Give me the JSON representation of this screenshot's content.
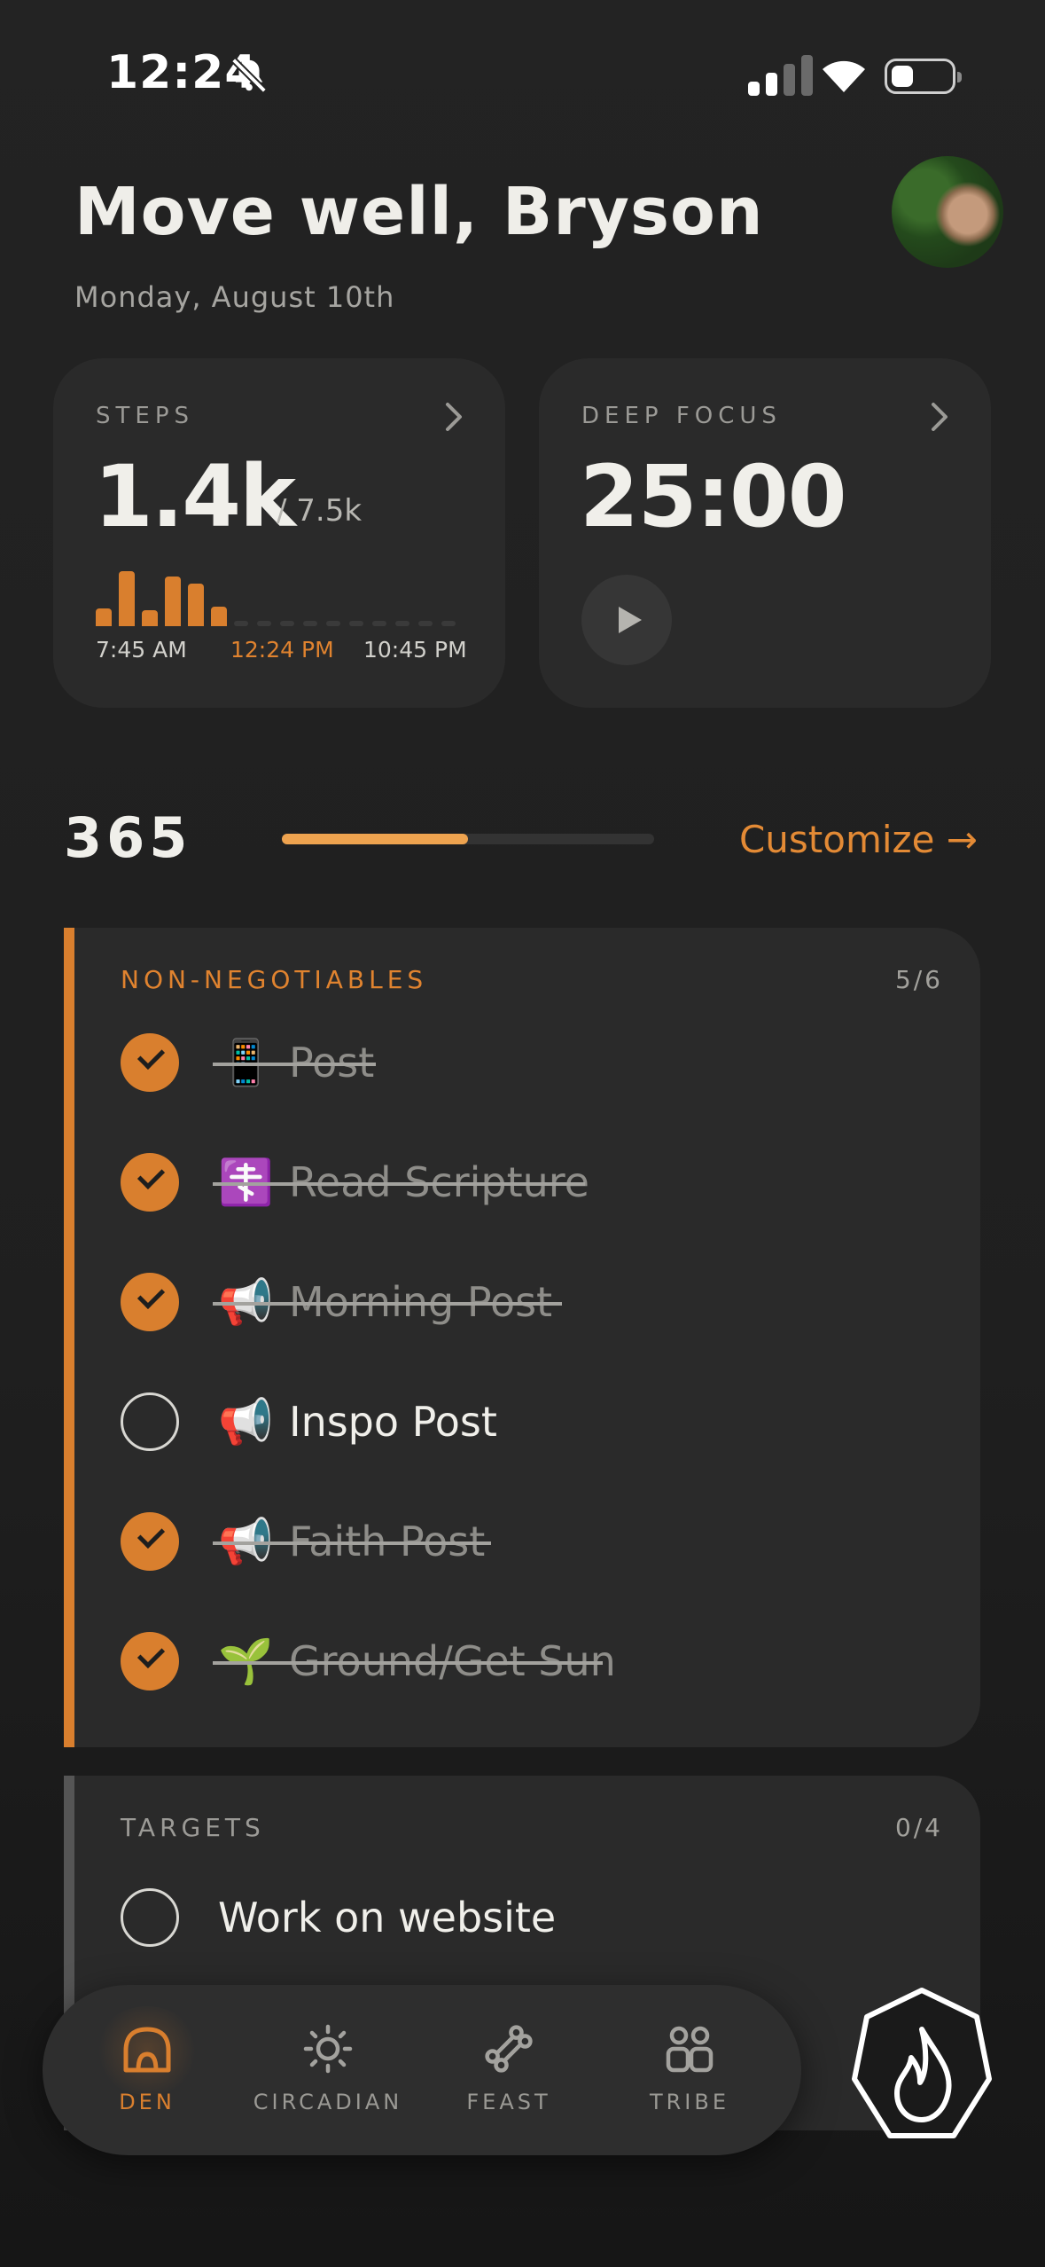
{
  "status": {
    "time": "12:24"
  },
  "header": {
    "greeting": "Move well, Bryson",
    "date": "Monday, August 10th"
  },
  "steps_card": {
    "label": "STEPS",
    "value": "1.4k",
    "goal": "/ 7.5k",
    "time_start": "7:45 AM",
    "time_now": "12:24 PM",
    "time_end": "10:45 PM",
    "accent_color": "#d97f2e"
  },
  "focus_card": {
    "label": "DEEP FOCUS",
    "timer": "25:00"
  },
  "streak": {
    "value": "365",
    "progress": 0.5,
    "customize": "Customize →"
  },
  "non_negotiables": {
    "title": "NON-NEGOTIABLES",
    "count": "5/6",
    "items": [
      {
        "emoji": "📱",
        "label": "Post",
        "done": true
      },
      {
        "emoji": "☦️",
        "label": "Read Scripture",
        "done": true
      },
      {
        "emoji": "📢",
        "label": "Morning Post",
        "done": true
      },
      {
        "emoji": "📢",
        "label": "Inspo Post",
        "done": false
      },
      {
        "emoji": "📢",
        "label": "Faith Post",
        "done": true
      },
      {
        "emoji": "🌱",
        "label": "Ground/Get Sun",
        "done": true
      }
    ]
  },
  "targets": {
    "title": "TARGETS",
    "count": "0/4",
    "items": [
      {
        "label": "Work on website",
        "done": false
      }
    ]
  },
  "nav": {
    "items": [
      {
        "label": "DEN",
        "icon": "den-icon",
        "active": true
      },
      {
        "label": "CIRCADIAN",
        "icon": "sun-icon",
        "active": false
      },
      {
        "label": "FEAST",
        "icon": "bone-icon",
        "active": false
      },
      {
        "label": "TRIBE",
        "icon": "tribe-icon",
        "active": false
      }
    ],
    "fab_icon": "flame-icon"
  }
}
